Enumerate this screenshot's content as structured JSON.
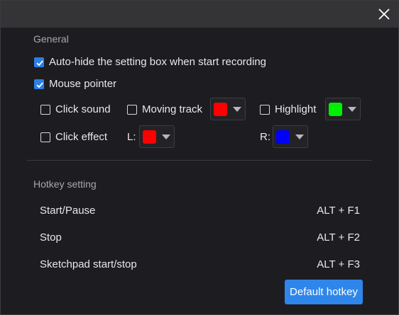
{
  "general": {
    "section_title": "General",
    "auto_hide": {
      "label": "Auto-hide the setting box when start recording",
      "checked": true
    },
    "mouse_pointer": {
      "label": "Mouse pointer",
      "checked": true
    },
    "click_sound": {
      "label": "Click sound",
      "checked": false
    },
    "moving_track": {
      "label": "Moving track",
      "checked": false,
      "color": "#ff0000"
    },
    "highlight": {
      "label": "Highlight",
      "checked": false,
      "color": "#00ee00"
    },
    "click_effect": {
      "label": "Click effect",
      "checked": false
    },
    "left_label": "L:",
    "left_color": "#ff0000",
    "right_label": "R:",
    "right_color": "#0000ff"
  },
  "hotkey": {
    "section_title": "Hotkey setting",
    "items": [
      {
        "name": "Start/Pause",
        "value": "ALT + F1"
      },
      {
        "name": "Stop",
        "value": "ALT + F2"
      },
      {
        "name": "Sketchpad start/stop",
        "value": "ALT + F3"
      }
    ],
    "default_button": "Default hotkey"
  },
  "icons": {
    "close": "close-icon",
    "check": "check-icon",
    "dropdown": "chevron-down-icon"
  },
  "colors": {
    "accent": "#2f86ea",
    "background": "#1d1d21",
    "titlebar": "#343437"
  }
}
